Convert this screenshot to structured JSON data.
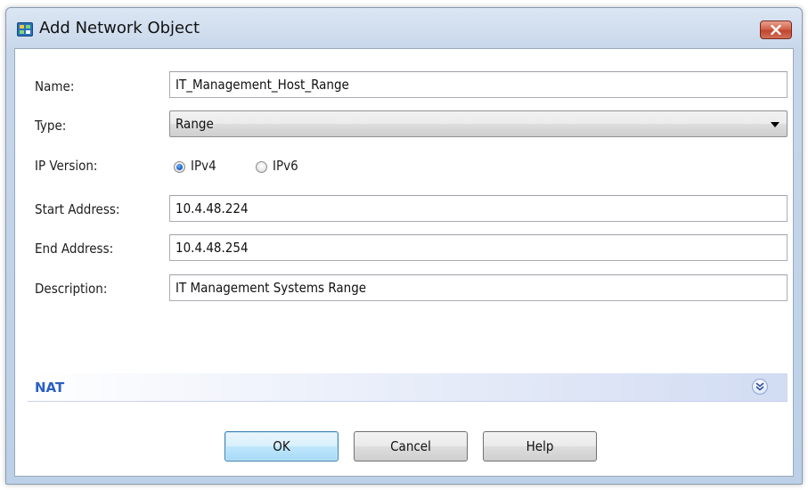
{
  "window": {
    "title": "Add Network Object"
  },
  "form": {
    "name_label": "Name:",
    "name_value": "IT_Management_Host_Range",
    "type_label": "Type:",
    "type_value": "Range",
    "ip_version_label": "IP Version:",
    "ipv4_label": "IPv4",
    "ipv6_label": "IPv6",
    "ip_version_selected": "IPv4",
    "start_label": "Start Address:",
    "start_value": "10.4.48.224",
    "end_label": "End Address:",
    "end_value": "10.4.48.254",
    "description_label": "Description:",
    "description_value": "IT Management Systems Range"
  },
  "nat": {
    "label": "NAT",
    "expand_icon": "double-chevron-down-icon"
  },
  "buttons": {
    "ok": "OK",
    "cancel": "Cancel",
    "help": "Help"
  },
  "colors": {
    "title_bar": "#c7d7ea",
    "close_button": "#c1452c",
    "nat_label": "#2b5fc4",
    "default_button": "#bee6fd"
  }
}
